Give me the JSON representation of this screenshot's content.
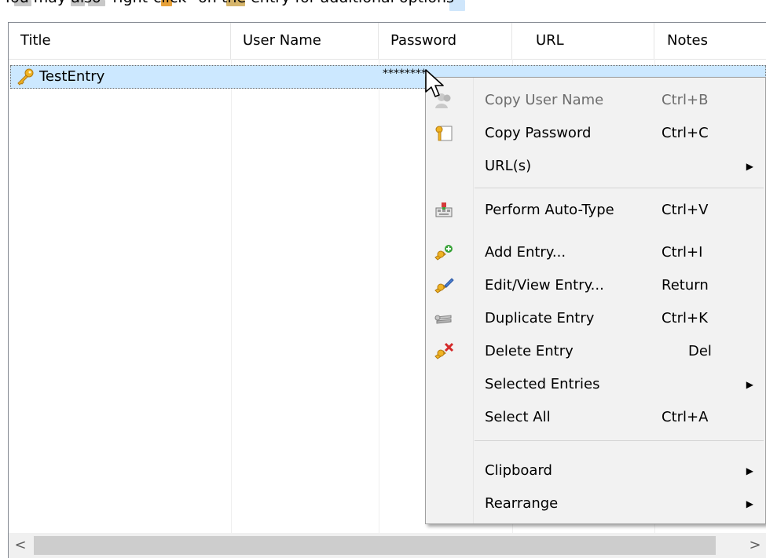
{
  "caption": "You may also \"right-click\" on the entry for additional options",
  "columns": {
    "title": "Title",
    "username": "User Name",
    "password": "Password",
    "url": "URL",
    "notes": "Notes"
  },
  "entry": {
    "icon": "key-icon",
    "title": "TestEntry",
    "password": "********"
  },
  "context_menu": {
    "copy_username": {
      "label": "Copy User Name",
      "shortcut": "Ctrl+B",
      "icon": "copy-user-icon",
      "disabled": true
    },
    "copy_password": {
      "label": "Copy Password",
      "shortcut": "Ctrl+C",
      "icon": "copy-password-icon"
    },
    "urls": {
      "label": "URL(s)",
      "submenu": true
    },
    "auto_type": {
      "label": "Perform Auto-Type",
      "shortcut": "Ctrl+V",
      "icon": "auto-type-icon"
    },
    "add_entry": {
      "label": "Add Entry...",
      "shortcut": "Ctrl+I",
      "icon": "add-entry-icon"
    },
    "edit_entry": {
      "label": "Edit/View Entry...",
      "shortcut": "Return",
      "icon": "edit-entry-icon"
    },
    "duplicate_entry": {
      "label": "Duplicate Entry",
      "shortcut": "Ctrl+K",
      "icon": "duplicate-entry-icon"
    },
    "delete_entry": {
      "label": "Delete Entry",
      "shortcut": "Del",
      "icon": "delete-entry-icon"
    },
    "selected_entries": {
      "label": "Selected Entries",
      "submenu": true
    },
    "select_all": {
      "label": "Select All",
      "shortcut": "Ctrl+A"
    },
    "clipboard": {
      "label": "Clipboard",
      "submenu": true
    },
    "rearrange": {
      "label": "Rearrange",
      "submenu": true
    }
  },
  "scrollbar": {
    "left_arrow": "<",
    "right_arrow": ">"
  },
  "colors": {
    "selection": "#cce8ff",
    "menu_bg": "#f2f2f2",
    "disabled_text": "#6d6d6d"
  }
}
